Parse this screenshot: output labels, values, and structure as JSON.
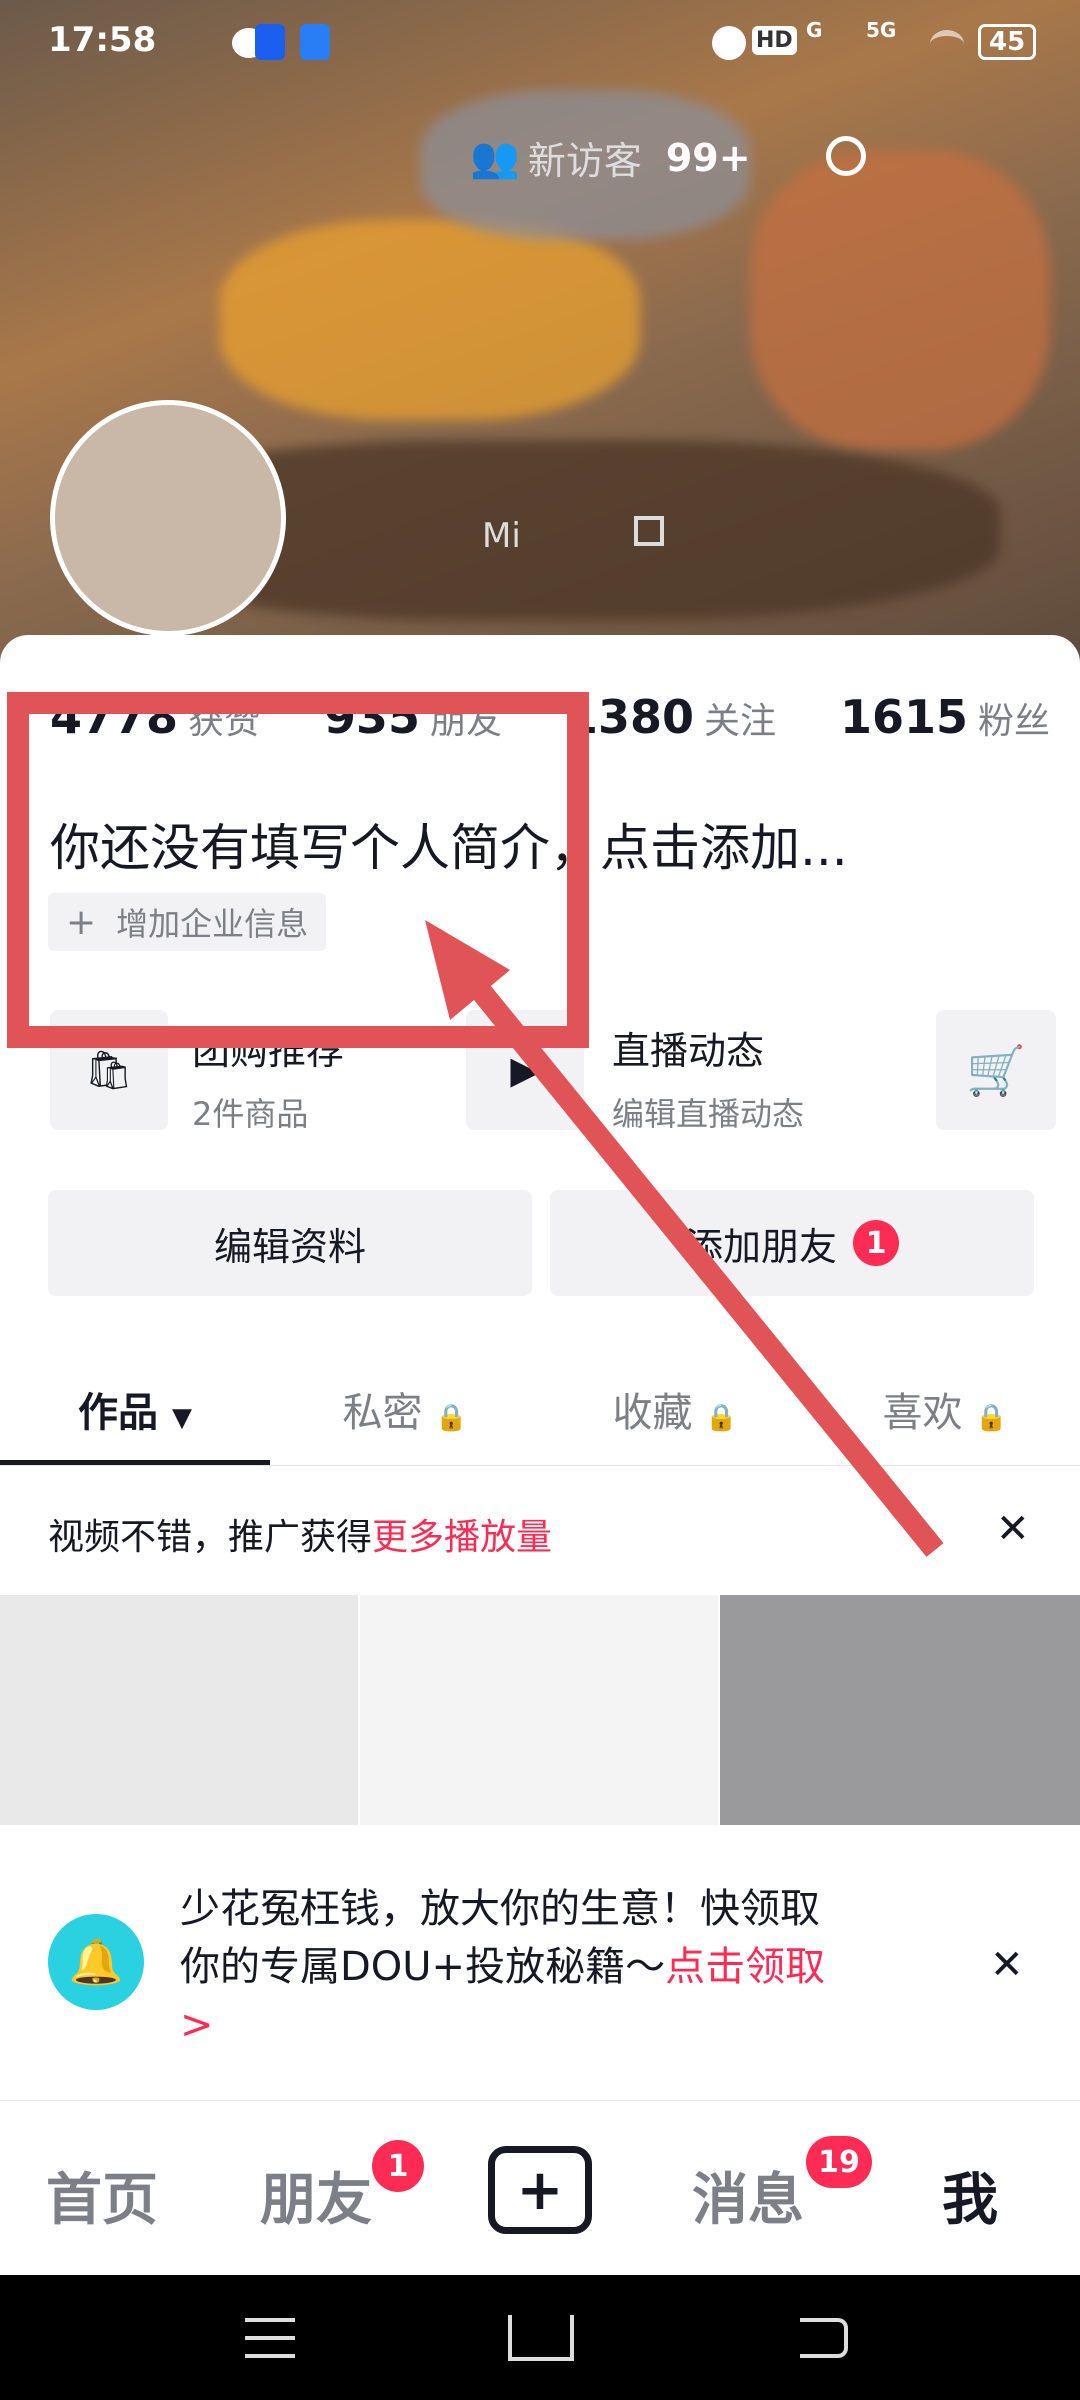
{
  "status_bar": {
    "time": "17:58",
    "battery": "45",
    "network_labels": [
      "HD",
      "G",
      "5G"
    ]
  },
  "header": {
    "visitors_label": "新访客",
    "visitors_count": "99+"
  },
  "profile": {
    "partial_id": "Mi"
  },
  "stats": [
    {
      "num": "4778",
      "label": "获赞"
    },
    {
      "num": "935",
      "label": "朋友"
    },
    {
      "num": "1380",
      "label": "关注"
    },
    {
      "num": "1615",
      "label": "粉丝"
    }
  ],
  "bio": "你还没有填写个人简介，点击添加...",
  "enterprise_chip": "增加企业信息",
  "services": [
    {
      "title": "团购推荐",
      "sub": "2件商品"
    },
    {
      "title": "直播动态",
      "sub": "编辑直播动态"
    }
  ],
  "buttons": {
    "edit": "编辑资料",
    "add_friend": "添加朋友",
    "add_friend_badge": "1"
  },
  "tabs": [
    {
      "label": "作品",
      "active": true
    },
    {
      "label": "私密",
      "locked": true
    },
    {
      "label": "收藏",
      "locked": true
    },
    {
      "label": "喜欢",
      "locked": true
    }
  ],
  "promo": {
    "text": "视频不错，推广获得",
    "highlight": "更多播放量"
  },
  "notice": {
    "line1": "少花冤枉钱，放大你的生意！快领取",
    "line2": "你的专属DOU+投放秘籍～",
    "link": "点击领取",
    "arrow": ">"
  },
  "bottom_nav": [
    {
      "label": "首页"
    },
    {
      "label": "朋友",
      "badge": "1"
    },
    {
      "label": "+"
    },
    {
      "label": "消息",
      "badge": "19"
    },
    {
      "label": "我",
      "active": true
    }
  ],
  "colors": {
    "accent": "#fe2c55",
    "annotation": "#e05458",
    "notice_icon": "#2ad1e0"
  }
}
